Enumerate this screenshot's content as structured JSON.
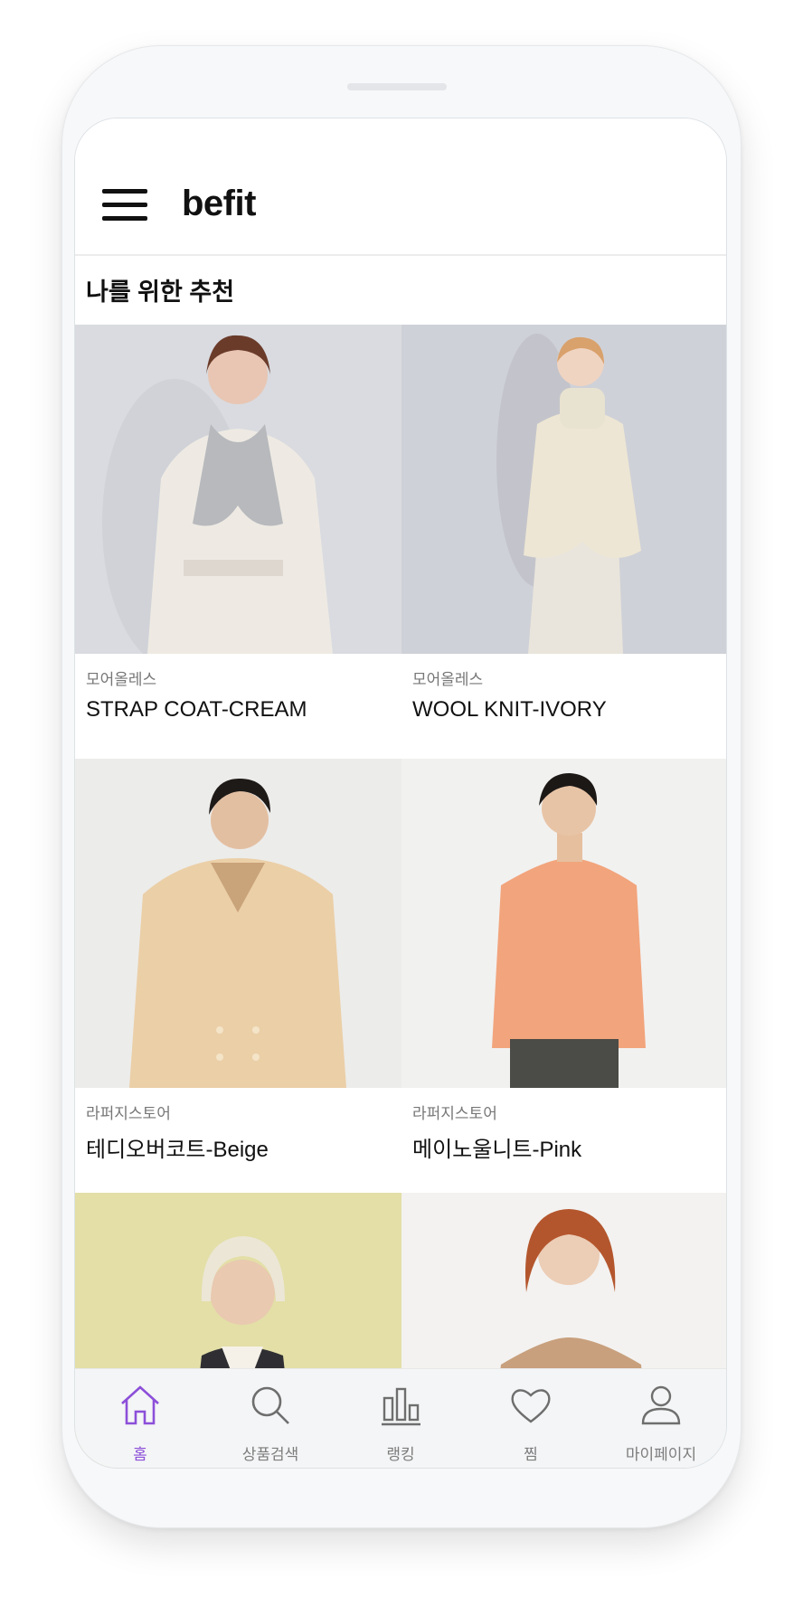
{
  "app": {
    "title": "befit"
  },
  "section": {
    "title": "나를 위한 추천"
  },
  "products": [
    {
      "brand": "모어올레스",
      "name": "STRAP COAT-CREAM"
    },
    {
      "brand": "모어올레스",
      "name": "WOOL KNIT-IVORY"
    },
    {
      "brand": "라퍼지스토어",
      "name": "테디오버코트-Beige"
    },
    {
      "brand": "라퍼지스토어",
      "name": "메이노울니트-Pink"
    },
    {
      "brand": "",
      "name": ""
    },
    {
      "brand": "",
      "name": ""
    }
  ],
  "nav": [
    {
      "label": "홈",
      "icon": "home-icon",
      "active": true
    },
    {
      "label": "상품검색",
      "icon": "search-icon",
      "active": false
    },
    {
      "label": "랭킹",
      "icon": "bar-chart-icon",
      "active": false
    },
    {
      "label": "찜",
      "icon": "heart-icon",
      "active": false
    },
    {
      "label": "마이페이지",
      "icon": "user-icon",
      "active": false
    }
  ],
  "colors": {
    "accent": "#8c4fd9",
    "nav_inactive": "#7d7d7d",
    "nav_bg": "#f4f5f6"
  }
}
